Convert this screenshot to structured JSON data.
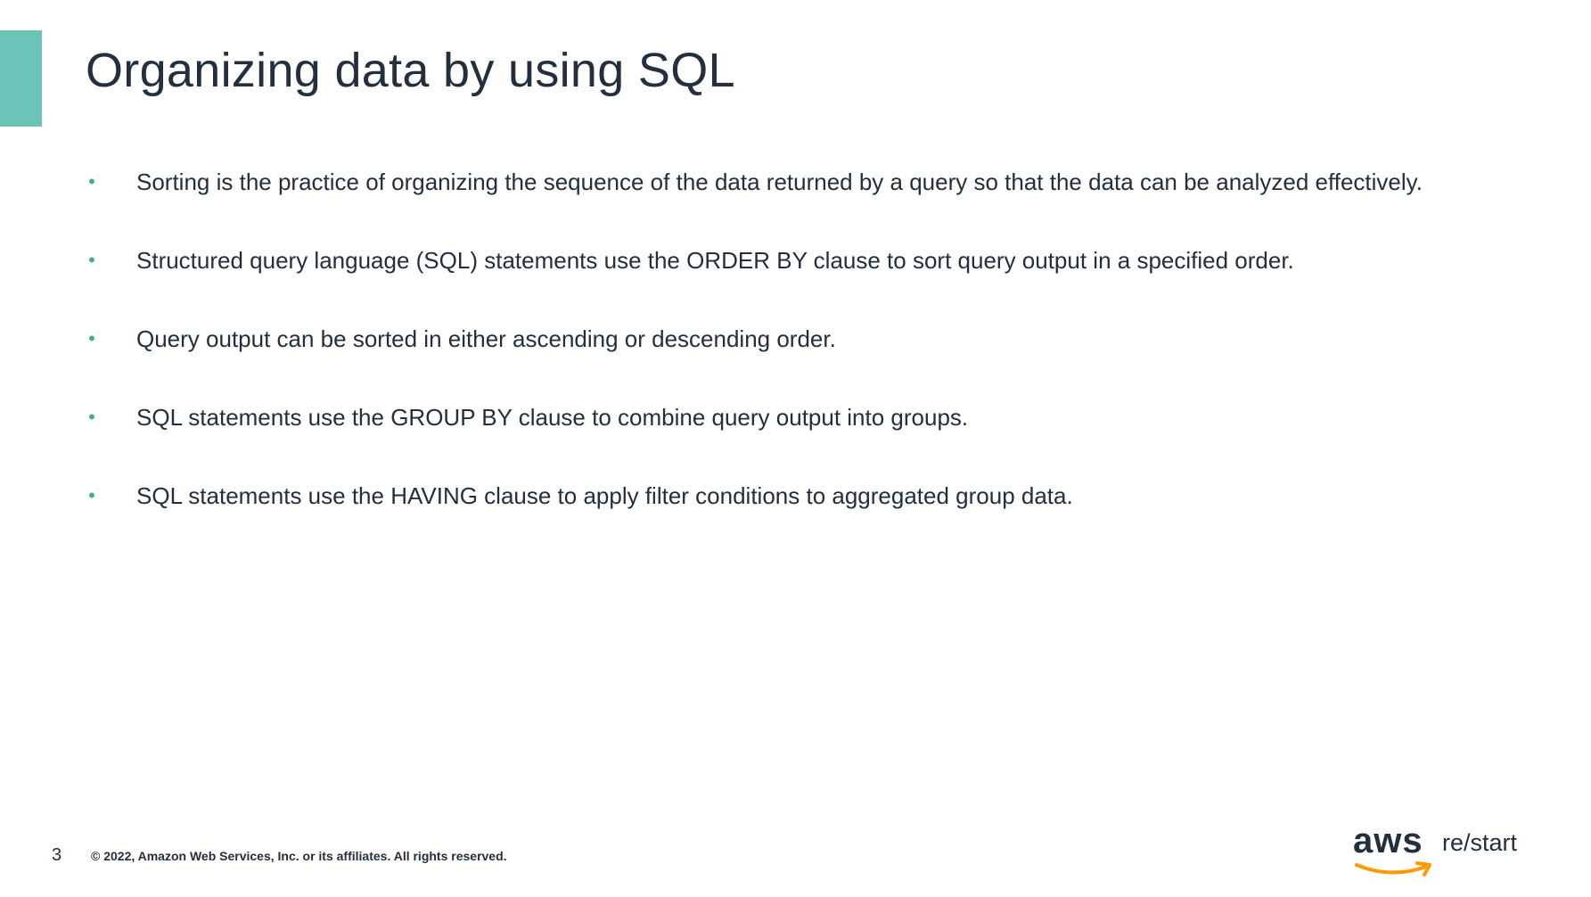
{
  "slide": {
    "title": "Organizing data by using SQL",
    "bullet_glyph": "•",
    "bullets": [
      "Sorting is the practice of organizing the sequence of the data returned by a query so that the data can be analyzed effectively.",
      "Structured query language (SQL) statements use the ORDER BY clause to sort query output in a specified order.",
      "Query output can be sorted in either ascending or descending order.",
      "SQL statements use the GROUP BY clause to combine query output into groups.",
      "SQL statements use the HAVING clause to apply filter conditions to aggregated group data."
    ]
  },
  "footer": {
    "page_number": "3",
    "copyright": "© 2022, Amazon Web Services, Inc. or its affiliates. All rights reserved."
  },
  "logo": {
    "brand": "aws",
    "product": "re/start"
  },
  "colors": {
    "accent": "#6cc3b7",
    "bullet": "#4aa89c",
    "text": "#232f3e",
    "logo_smile": "#ff9900"
  },
  "icons": {
    "accent_bar": "teal-accent-bar",
    "logo_smile": "aws-smile-arrow-icon"
  }
}
